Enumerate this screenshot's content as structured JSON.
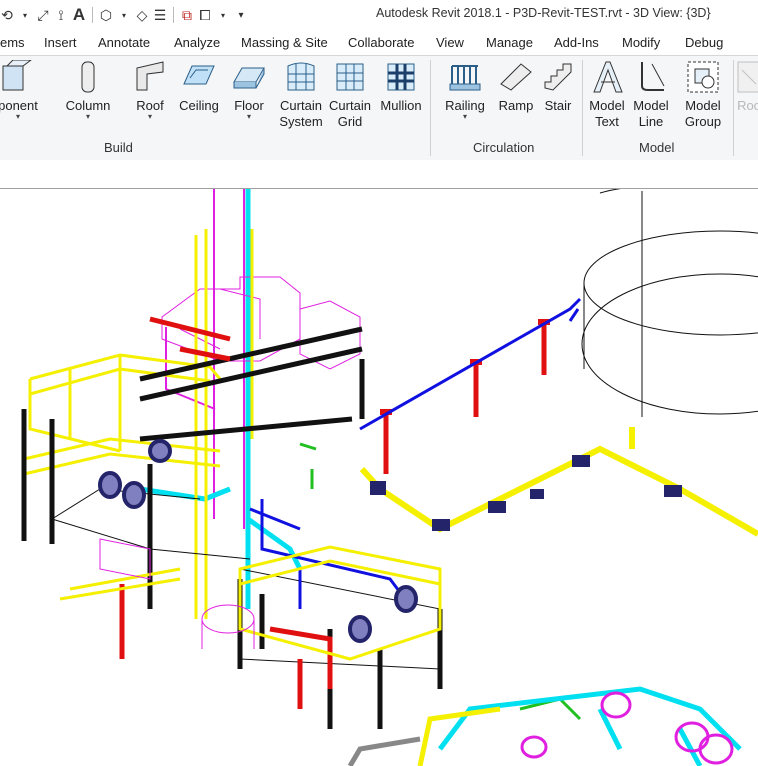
{
  "window": {
    "title": "Autodesk Revit 2018.1 -    P3D-Revit-TEST.rvt - 3D View: {3D}"
  },
  "quick_access": [
    {
      "name": "undo-icon",
      "glyph": "⟲"
    },
    {
      "name": "measure-icon",
      "glyph": "⤢"
    },
    {
      "name": "dimension-icon",
      "glyph": "⟟"
    },
    {
      "name": "text-icon",
      "glyph": "A"
    },
    {
      "name": "3d-view-icon",
      "glyph": "⬡"
    },
    {
      "name": "section-icon",
      "glyph": "◇"
    },
    {
      "name": "thin-lines-icon",
      "glyph": "☰"
    },
    {
      "name": "close-hidden-icon",
      "glyph": "⧉"
    },
    {
      "name": "switch-windows-icon",
      "glyph": "⧠"
    },
    {
      "name": "customize-icon",
      "glyph": "▾"
    }
  ],
  "menu_tabs": [
    "ems",
    "Insert",
    "Annotate",
    "Analyze",
    "Massing & Site",
    "Collaborate",
    "View",
    "Manage",
    "Add-Ins",
    "Modify",
    "Debug"
  ],
  "ribbon": {
    "tools": [
      {
        "label": "ponent",
        "label2": "",
        "dropdown": true
      },
      {
        "label": "Column",
        "label2": "",
        "dropdown": true
      },
      {
        "label": "Roof",
        "label2": "",
        "dropdown": true
      },
      {
        "label": "Ceiling",
        "label2": "",
        "dropdown": false
      },
      {
        "label": "Floor",
        "label2": "",
        "dropdown": true
      },
      {
        "label": "Curtain",
        "label2": "System",
        "dropdown": false
      },
      {
        "label": "Curtain",
        "label2": "Grid",
        "dropdown": false
      },
      {
        "label": "Mullion",
        "label2": "",
        "dropdown": false
      },
      {
        "label": "Railing",
        "label2": "",
        "dropdown": true
      },
      {
        "label": "Ramp",
        "label2": "",
        "dropdown": false
      },
      {
        "label": "Stair",
        "label2": "",
        "dropdown": false
      },
      {
        "label": "Model",
        "label2": "Text",
        "dropdown": false
      },
      {
        "label": "Model",
        "label2": "Line",
        "dropdown": false
      },
      {
        "label": "Model",
        "label2": "Group",
        "dropdown": true
      },
      {
        "label": "Roo",
        "label2": "",
        "dropdown": false
      }
    ],
    "panels": [
      "Build",
      "Circulation",
      "Model"
    ]
  },
  "colors": {
    "structure_yellow": "#f5f000",
    "pipe_blue": "#1010e0",
    "pipe_red": "#e01010",
    "pipe_cyan": "#00e0f0",
    "pipe_magenta": "#e020e0",
    "steel_black": "#111111",
    "support_navy": "#24246a",
    "pipe_green": "#20c020",
    "pipe_grey": "#888888"
  }
}
